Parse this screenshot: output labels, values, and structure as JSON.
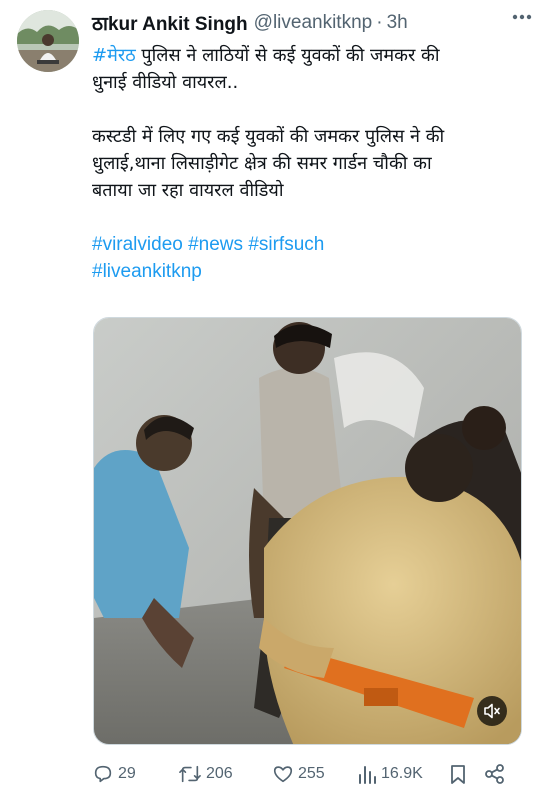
{
  "author": {
    "display_name": "ठाkur Ankit Singh",
    "handle": "@liveankitknp",
    "separator": "·",
    "time": "3h"
  },
  "tweet": {
    "hashtag_1": "#मेरठ",
    "line_1_rest": " पुलिस ने लाठियों से कई युवकों की जमकर की",
    "line_2": "धुनाई वीडियो वायरल..",
    "line_3": "कस्टडी में लिए गए कई युवकों की जमकर पुलिस ने की",
    "line_4": "धुलाई,थाना लिसाड़ीगेट क्षेत्र की समर गार्डन चौकी का",
    "line_5": "बताया जा रहा वायरल वीडियो",
    "hashtags_line_1": [
      "#viralvideo",
      "#news",
      "#sirfsuch"
    ],
    "hashtags_line_2": [
      "#liveankitknp"
    ]
  },
  "media": {
    "type": "video",
    "mute_icon": "speaker-muted-icon"
  },
  "actions": {
    "replies": "29",
    "retweets": "206",
    "likes": "255",
    "views": "16.9K"
  },
  "colors": {
    "link": "#1d9bf0",
    "secondary_text": "#536471",
    "primary_text": "#0f1419"
  }
}
